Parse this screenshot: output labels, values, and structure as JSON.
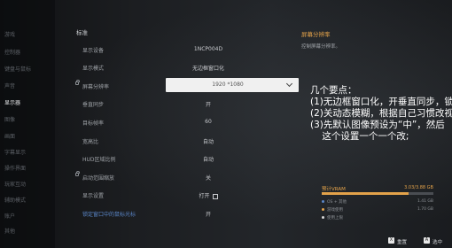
{
  "sidebar": {
    "items": [
      {
        "label": "游戏"
      },
      {
        "label": "控制器"
      },
      {
        "label": "键盘与鼠标"
      },
      {
        "label": "声音"
      },
      {
        "label": "显示器"
      },
      {
        "label": "图像"
      },
      {
        "label": "画面"
      },
      {
        "label": "字幕显示"
      },
      {
        "label": "操作界面"
      },
      {
        "label": "玩家互动"
      },
      {
        "label": "辅助模式"
      },
      {
        "label": "账户"
      },
      {
        "label": "其他"
      }
    ],
    "active_index": 4
  },
  "settings": {
    "section_title": "标准",
    "rows": [
      {
        "label": "显示设备",
        "value": "1NCP004D",
        "locked": false
      },
      {
        "label": "显示模式",
        "value": "无边框窗口化",
        "locked": false
      },
      {
        "label": "屏幕分辨率",
        "value": "1920 *1080",
        "locked": true,
        "dropdown": true
      },
      {
        "label": "垂直同步",
        "value": "开",
        "locked": false
      },
      {
        "label": "目标帧率",
        "value": "60",
        "locked": false
      },
      {
        "label": "宽高比",
        "value": "自动",
        "locked": false
      },
      {
        "label": "HUD区域比例",
        "value": "自动",
        "locked": false
      },
      {
        "label": "启动范围缩放",
        "value": "关",
        "locked": true
      },
      {
        "label": "显示设置",
        "value": "打开",
        "locked": false,
        "external": true
      },
      {
        "label": "锁定窗口中的鼠标光标",
        "value": "开",
        "locked": false,
        "link": true
      }
    ]
  },
  "info": {
    "title": "屏幕分辨率",
    "desc": "控制屏幕分辨率。"
  },
  "note": {
    "text": "几个要点：\n(1)无边框窗口化，开垂直同步，锁\n(2)关动态模糊，根据自己习惯改视\n(3)先默认图像预设为“中”，然后\n    这个设置一个一个改;"
  },
  "vram": {
    "title": "预计VRAM",
    "usage": "3.03/3.88 GB",
    "fill_fraction": 0.78,
    "rows": [
      {
        "label": "OS + 其他",
        "value": "1.41 GB",
        "color": "#5a86c8"
      },
      {
        "label": "游戏使用",
        "value": "1.70 GB",
        "color": "#e3a24a"
      },
      {
        "label": "使用上限",
        "value": "",
        "color": "#d8d8d8"
      }
    ]
  },
  "footer": {
    "reset_key": "X",
    "reset_label": "重置",
    "select_key": "A",
    "select_label": "选中"
  },
  "colors": {
    "accent": "#e3a24a",
    "link": "#5a86c8",
    "background": "#181a1d"
  }
}
